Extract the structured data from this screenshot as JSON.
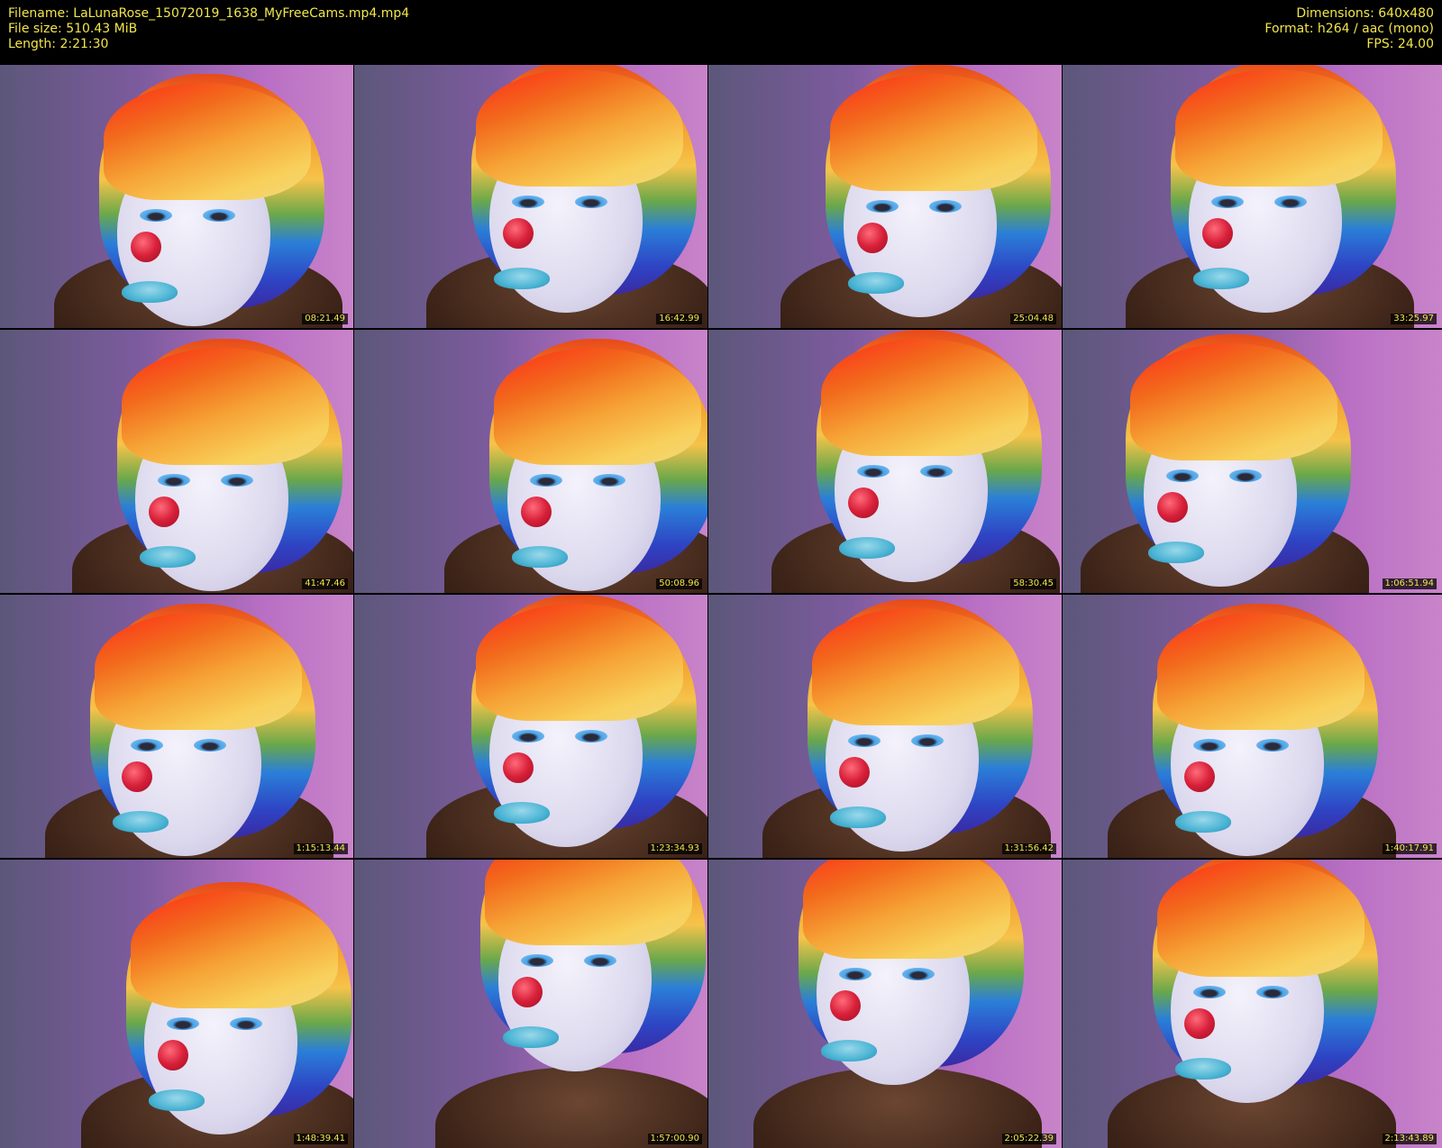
{
  "header": {
    "left": [
      "Filename: LaLunaRose_15072019_1638_MyFreeCams.mp4.mp4",
      "File size: 510.43 MiB",
      "Length: 2:21:30"
    ],
    "right": [
      "Dimensions: 640x480",
      "Format: h264 / aac (mono)",
      "FPS: 24.00"
    ]
  },
  "thumbnails": [
    {
      "timestamp": "08:21.49"
    },
    {
      "timestamp": "16:42.99"
    },
    {
      "timestamp": "25:04.48"
    },
    {
      "timestamp": "33:25.97"
    },
    {
      "timestamp": "41:47.46"
    },
    {
      "timestamp": "50:08.96"
    },
    {
      "timestamp": "58:30.45"
    },
    {
      "timestamp": "1:06:51.94"
    },
    {
      "timestamp": "1:15:13.44"
    },
    {
      "timestamp": "1:23:34.93"
    },
    {
      "timestamp": "1:31:56.42"
    },
    {
      "timestamp": "1:40:17.91"
    },
    {
      "timestamp": "1:48:39.41"
    },
    {
      "timestamp": "1:57:00.90"
    },
    {
      "timestamp": "2:05:22.39"
    },
    {
      "timestamp": "2:13:43.89"
    }
  ],
  "colors": {
    "text": "#f2e64a",
    "background": "#000000"
  }
}
